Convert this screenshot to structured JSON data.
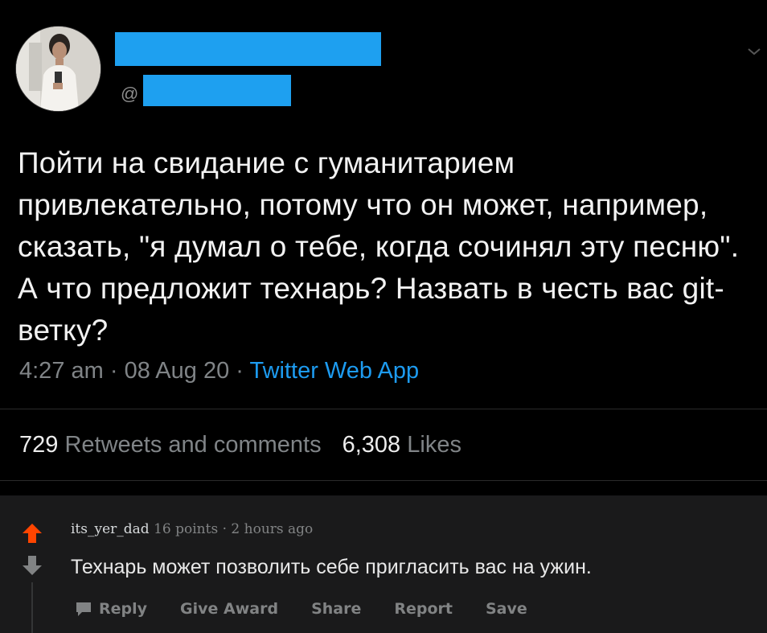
{
  "tweet": {
    "handle_prefix": "@",
    "text": "Пойти на свидание с гуманитарием привлекательно, потому что он может, например, сказать, \"я думал о тебе, когда сочинял эту песню\". А что предложит технарь? Назвать в честь вас git-ветку?",
    "time": "4:27 am",
    "date": "08 Aug 20",
    "source": "Twitter Web App",
    "separator": " · ",
    "retweets_count": "729",
    "retweets_label": "Retweets and comments",
    "likes_count": "6,308",
    "likes_label": "Likes",
    "redaction_color": "#1ea0f0"
  },
  "comment": {
    "username": "its_yer_dad",
    "points": "16 points",
    "separator": " · ",
    "age": "2 hours ago",
    "body": "Технарь может позволить себе пригласить вас на ужин.",
    "actions": {
      "reply": "Reply",
      "give_award": "Give Award",
      "share": "Share",
      "report": "Report",
      "save": "Save"
    },
    "icons": {
      "upvote": "arrow-up-icon",
      "downvote": "arrow-down-icon",
      "reply": "speech-bubble-icon"
    },
    "upvote_color": "#ff4500"
  }
}
